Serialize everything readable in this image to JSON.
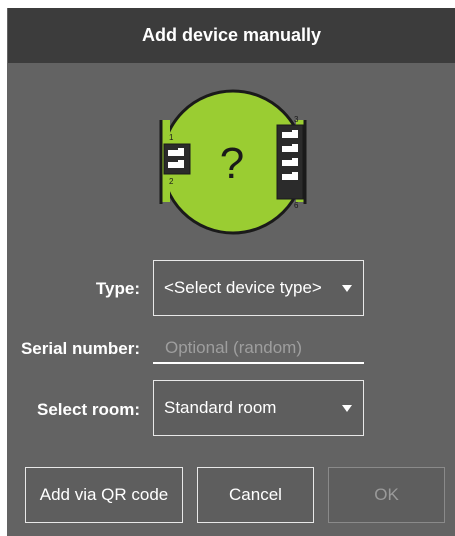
{
  "dialog": {
    "title": "Add device manually"
  },
  "device_image": {
    "placeholder_symbol": "?",
    "left_terminal_labels": [
      "1",
      "2"
    ],
    "right_terminal_labels": [
      "3",
      "6"
    ],
    "body_color": "#9acd32"
  },
  "form": {
    "type_label": "Type:",
    "type_value": "<Select device type>",
    "serial_label": "Serial number:",
    "serial_value": "",
    "serial_placeholder": "Optional (random)",
    "room_label": "Select room:",
    "room_value": "Standard room"
  },
  "buttons": {
    "qr_label": "Add via QR code",
    "cancel_label": "Cancel",
    "ok_label": "OK"
  },
  "colors": {
    "dialog_bg": "#636363",
    "header_bg": "#3c3c3c",
    "device_green": "#9acd32"
  }
}
